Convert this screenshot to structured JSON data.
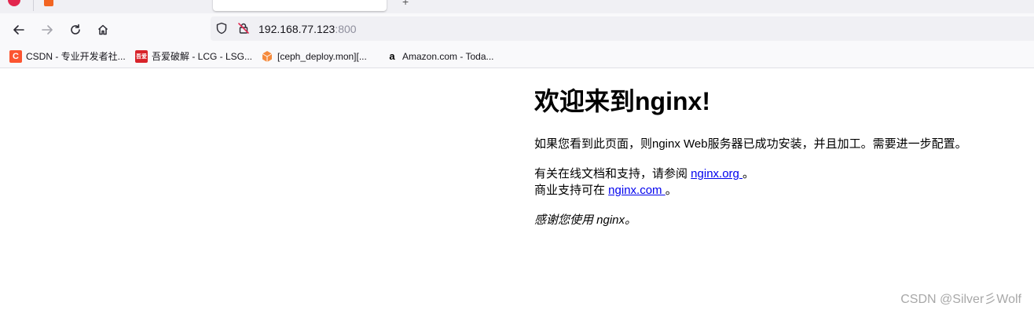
{
  "browser": {
    "tabs": [
      {
        "label": "",
        "active": false
      },
      {
        "label": "",
        "active": true
      }
    ],
    "url": {
      "host": "192.168.77.123",
      "port": ":800"
    },
    "bookmarks": [
      {
        "label": "CSDN - 专业开发者社...",
        "icon": "csdn-icon",
        "color": "#fc5531"
      },
      {
        "label": "吾爱破解 - LCG - LSG...",
        "icon": "52pojie-icon",
        "color": "#d8232a"
      },
      {
        "label": "[ceph_deploy.mon][...",
        "icon": "cube-icon",
        "color": "#f58a3c"
      },
      {
        "label": "Amazon.com - Toda...",
        "icon": "amazon-icon",
        "color": "#ff9900"
      }
    ]
  },
  "page": {
    "title": "欢迎来到nginx!",
    "para1": "如果您看到此页面，则nginx Web服务器已成功安装，并且加工。需要进一步配置。",
    "para2_prefix": "有关在线文档和支持，请参阅 ",
    "link_org": "nginx.org ",
    "para2_suffix": "。",
    "para2b_prefix": "商业支持可在 ",
    "link_com": "nginx.com ",
    "para2b_suffix": "。",
    "para3": "感谢您使用 nginx。"
  },
  "watermark": "CSDN @Silver彡Wolf"
}
